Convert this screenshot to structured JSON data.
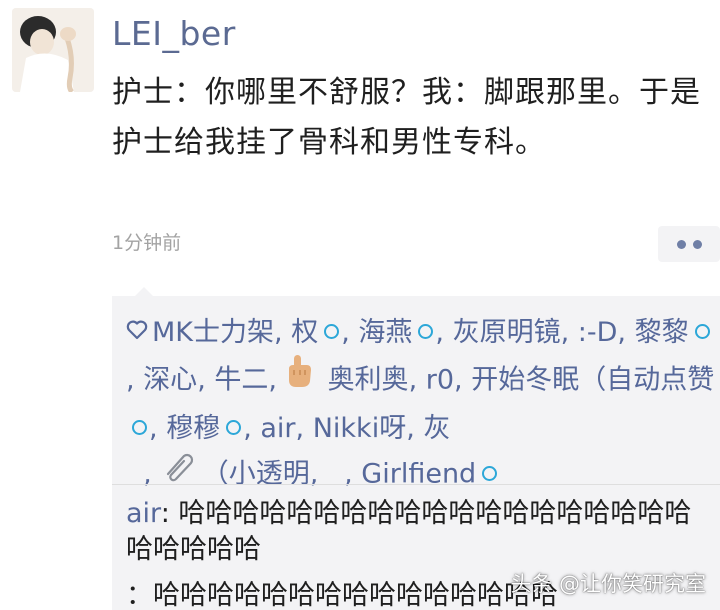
{
  "post": {
    "username": "LEI_ber",
    "text": "护士：你哪里不舒服？我：脚跟那里。于是护士给我挂了骨科和男性专科。",
    "timestamp": "1分钟前"
  },
  "likes": {
    "names": [
      "MK士力架",
      "权",
      "海燕",
      "灰原明镜",
      ":-D",
      "黎黎",
      "深心",
      "牛二",
      "奥利奥",
      "r0",
      "开始冬眠（自动点赞",
      "穆穆",
      "air",
      "Nikki呀",
      "灰",
      "（小透明",
      "Girlfiend"
    ],
    "separator": ",",
    "verified_color": "#2ca7d8",
    "link_color": "#56689a"
  },
  "comments": [
    {
      "author": "air",
      "text": "哈哈哈哈哈哈哈哈哈哈哈哈哈哈哈哈哈哈哈哈哈哈哈哈"
    },
    {
      "author": "",
      "text": "：哈哈哈哈哈哈哈哈哈哈哈哈哈哈哈"
    }
  ],
  "watermark": "头条 @让你笑研究室"
}
